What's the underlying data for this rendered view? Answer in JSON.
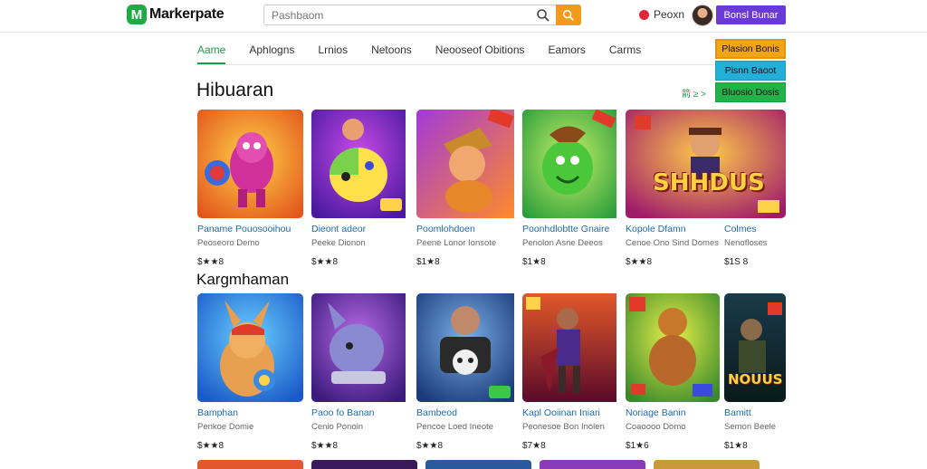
{
  "header": {
    "logo_text": "Markerpate",
    "logo_mark": "M",
    "search_placeholder": "Pashbaom",
    "user_name": "Peoxn",
    "cta_label": "Bonsl Bunar"
  },
  "tabs": [
    "Aame",
    "Aphlogns",
    "Lrnios",
    "Netoons",
    "Neooseof Obitions",
    "Eamors",
    "Carms"
  ],
  "side_buttons": [
    "Plasion Bonis",
    "Pisnn Baoot",
    "Bluosio Dosis"
  ],
  "sections": [
    {
      "title": "Hibuaran",
      "see_all": "箭 ≥ >",
      "cards": [
        {
          "title": "Paname Pouosooihou",
          "sub": "Peoseoro Demo",
          "price": "$★★8"
        },
        {
          "title": "Dieont adeor",
          "sub": "Peeke Dionon",
          "price": "$★★8"
        },
        {
          "title": "Poomlohdoen",
          "sub": "Peene Lonor Ionsote",
          "price": "$1★8"
        },
        {
          "title": "Poonhdlobtte Gnaire",
          "sub": "Penolon Asne Deeos",
          "price": "$1★8"
        },
        {
          "title": "Kopole Dfamn",
          "sub": "Cenoe Ono Sind Domes",
          "price": "$★★8"
        },
        {
          "title": "Colmes",
          "sub": "Nenofloses",
          "price": "$1S 8"
        }
      ]
    },
    {
      "title": "Kargmhaman",
      "cards": [
        {
          "title": "Bamphan",
          "sub": "Penkoe Domie",
          "price": "$★★8"
        },
        {
          "title": "Paoo fo Banan",
          "sub": "Cenio Ponoin",
          "price": "$★★8"
        },
        {
          "title": "Bambeod",
          "sub": "Pencoe Loed Ineote",
          "price": "$★★8"
        },
        {
          "title": "Kapl Ooiinan Iniari",
          "sub": "Peonesoe Bon Inolen",
          "price": "$7★8"
        },
        {
          "title": "Noriage Banin",
          "sub": "Coaoooo Domo",
          "price": "$1★6"
        },
        {
          "title": "Bamitt",
          "sub": "Semon Beele",
          "price": "$1★8"
        }
      ]
    }
  ],
  "thumb_texts": {
    "shhdus": "SHHDUS",
    "nouus": "NOUUS"
  },
  "colors": {
    "accent_green": "#1a9e4a",
    "search_orange": "#f29a1a",
    "cta_purple": "#6a3ad6",
    "side_orange": "#f2a417",
    "side_teal": "#22b0d8",
    "side_green": "#22b24a"
  }
}
